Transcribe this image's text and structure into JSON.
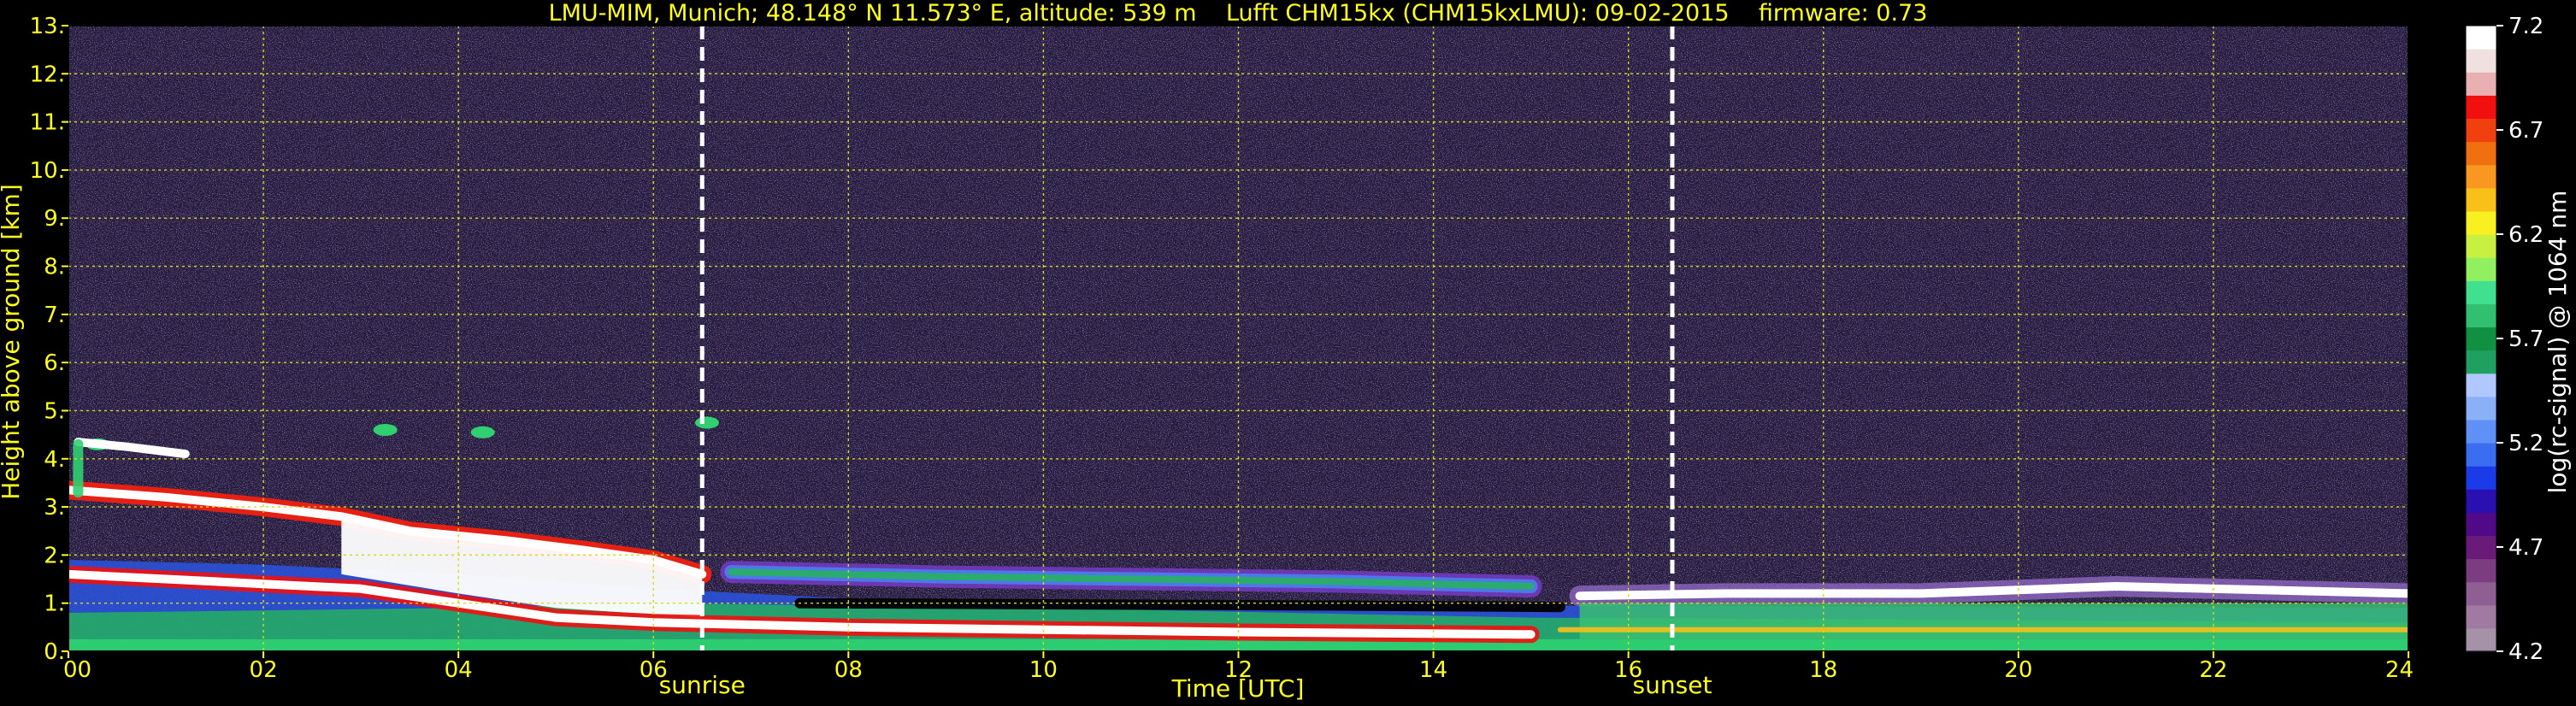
{
  "chart_data": {
    "type": "heatmap",
    "title": "LMU-MIM, Munich; 48.148° N 11.573° E, altitude: 539 m    Lufft CHM15kx (CHM15kxLMU): 09-02-2015    firmware: 0.73",
    "xlabel": "Time [UTC]",
    "ylabel": "Height above ground [km]",
    "xlim": [
      0,
      24
    ],
    "ylim": [
      0,
      13
    ],
    "x_ticks": [
      "00",
      "02",
      "04",
      "06",
      "08",
      "10",
      "12",
      "14",
      "16",
      "18",
      "20",
      "22",
      "24"
    ],
    "y_ticks": [
      "0.",
      "1.",
      "2.",
      "3.",
      "4.",
      "5.",
      "6.",
      "7.",
      "8.",
      "9.",
      "10.",
      "11.",
      "12.",
      "13."
    ],
    "grid": true,
    "annotations": [
      {
        "label": "sunrise",
        "x": 6.5
      },
      {
        "label": "sunset",
        "x": 16.45
      }
    ],
    "colorbar": {
      "label": "log(rc-signal) @ 1064 nm",
      "range": [
        4.2,
        7.2
      ],
      "ticks": [
        "4.2",
        "4.7",
        "5.2",
        "5.7",
        "6.2",
        "6.7",
        "7.2"
      ],
      "colors": [
        "#a592a8",
        "#a07aa0",
        "#8f5e92",
        "#7c3d80",
        "#6a1a78",
        "#500a88",
        "#2a10b0",
        "#1b3ae8",
        "#3a6df0",
        "#5f90f5",
        "#8ab0f8",
        "#b0c8ff",
        "#20a060",
        "#109040",
        "#30c070",
        "#40e090",
        "#90f060",
        "#c8f040",
        "#f8f020",
        "#f8c018",
        "#f89820",
        "#f07010",
        "#f04010",
        "#f01010",
        "#e8b0b0",
        "#f0e0e0",
        "#ffffff"
      ]
    },
    "features": {
      "boundary_layer_top_km": [
        [
          0.0,
          3.35
        ],
        [
          1.0,
          3.2
        ],
        [
          2.0,
          3.0
        ],
        [
          2.8,
          2.8
        ],
        [
          3.5,
          2.5
        ],
        [
          4.5,
          2.3
        ],
        [
          5.3,
          2.1
        ],
        [
          6.0,
          1.9
        ],
        [
          6.5,
          1.6
        ]
      ],
      "residual_layer_km": [
        [
          0.0,
          1.6
        ],
        [
          1.0,
          1.5
        ],
        [
          2.0,
          1.4
        ],
        [
          3.0,
          1.3
        ],
        [
          4.0,
          1.0
        ],
        [
          5.0,
          0.7
        ],
        [
          6.0,
          0.6
        ],
        [
          7.0,
          0.55
        ],
        [
          8.0,
          0.5
        ],
        [
          10.0,
          0.45
        ],
        [
          12.0,
          0.4
        ],
        [
          15.0,
          0.35
        ]
      ],
      "elevated_aerosol_layer_km": [
        [
          6.8,
          1.65
        ],
        [
          9.0,
          1.55
        ],
        [
          11.0,
          1.5
        ],
        [
          13.0,
          1.45
        ],
        [
          15.0,
          1.35
        ]
      ],
      "cloud_layer_km": [
        [
          15.5,
          1.15
        ],
        [
          17.0,
          1.2
        ],
        [
          19.0,
          1.2
        ],
        [
          21.0,
          1.35
        ],
        [
          24.0,
          1.2
        ]
      ],
      "cloud_cells_km": [
        [
          0.3,
          4.3
        ],
        [
          3.25,
          4.6
        ],
        [
          4.25,
          4.55
        ],
        [
          6.55,
          4.75
        ]
      ]
    }
  }
}
